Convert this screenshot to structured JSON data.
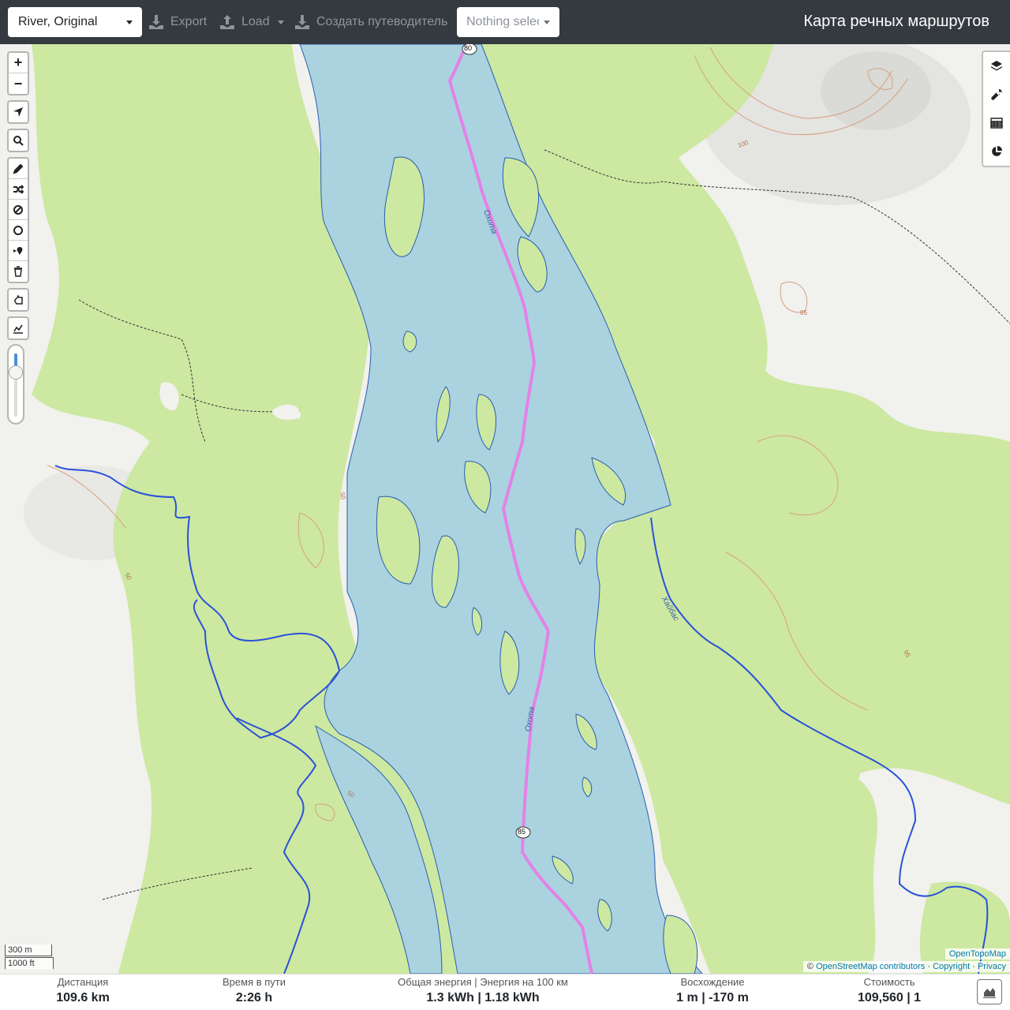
{
  "toolbar": {
    "profile": "River, Original",
    "export": "Export",
    "load": "Load",
    "guide": "Создать путеводитель",
    "selection_placeholder": "Nothing selected",
    "title": "Карта речных маршрутов"
  },
  "zoom": {
    "in": "+",
    "out": "−"
  },
  "zoom_slider_level": 0.3,
  "map_labels": {
    "river_name_1": "Охота",
    "river_name_2": "Охота",
    "tributary_name": "Хайбас",
    "marker_80": "80",
    "marker_85": "85",
    "contour_100": "100",
    "contour_50a": "50",
    "contour_50b": "50",
    "contour_50c": "50",
    "contour_95": "95",
    "contour_05": "05"
  },
  "scale": {
    "metric": "300 m",
    "imperial": "1000 ft"
  },
  "attribution": {
    "tiles": "OpenTopoMap",
    "prefix": "©",
    "osm": "OpenStreetMap contributors",
    "copyright": "Copyright",
    "privacy": "Privacy",
    "sep": "·"
  },
  "stats": {
    "distance_label": "Дистанция",
    "distance_value": "109.6 km",
    "time_label": "Время в пути",
    "time_value": "2:26 h",
    "energy_label": "Общая энергия | Энергия на 100 км",
    "energy_value": "1.3 kWh | 1.18 kWh",
    "ascent_label": "Восхождение",
    "ascent_value": "1 m | -170 m",
    "cost_label": "Стоимость",
    "cost_value": "109,560 | 1"
  },
  "colors": {
    "water": "#aad3df",
    "forest": "#cde8a1",
    "route": "#e382e6",
    "stream": "#2a52d8",
    "topbar": "#343a40"
  }
}
